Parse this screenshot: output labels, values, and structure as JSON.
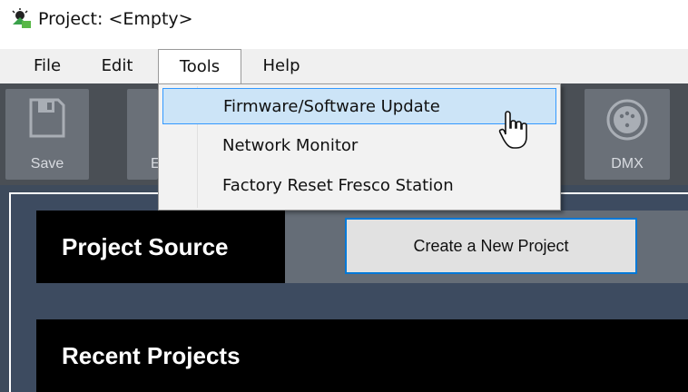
{
  "window": {
    "title": "Project: <Empty>"
  },
  "menubar": {
    "items": [
      {
        "label": "File"
      },
      {
        "label": "Edit"
      },
      {
        "label": "Tools"
      },
      {
        "label": "Help"
      }
    ]
  },
  "toolbar": {
    "save_label": "Save",
    "partial_label": "E",
    "dmx_label": "DMX"
  },
  "tools_menu": {
    "items": [
      {
        "label": "Firmware/Software Update"
      },
      {
        "label": "Network Monitor"
      },
      {
        "label": "Factory Reset Fresco Station"
      }
    ]
  },
  "project_source": {
    "title": "Project Source",
    "create_button": "Create a New Project"
  },
  "recent_projects": {
    "title": "Recent Projects"
  },
  "colors": {
    "toolbar_bg": "#4a4f55",
    "main_bg": "#3e4b5c",
    "highlight": "#cce4f7",
    "accent": "#0078d7"
  }
}
